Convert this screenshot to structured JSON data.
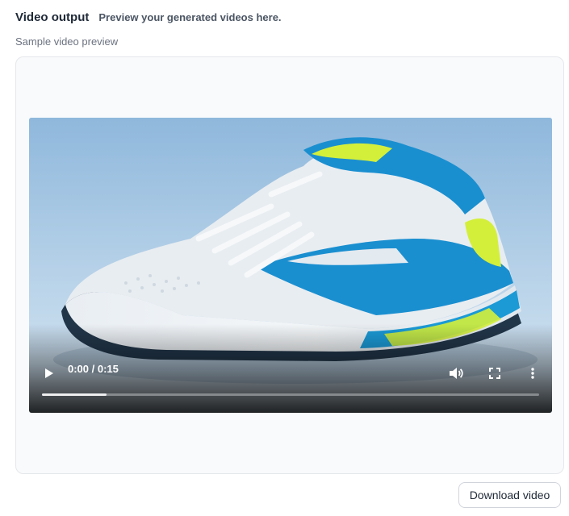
{
  "header": {
    "title": "Video output",
    "subtitle": "Preview your generated videos here."
  },
  "caption": "Sample video preview",
  "video": {
    "time_display": "0:00 / 0:15",
    "progress": 0.13,
    "controls": {
      "play_icon": "play-icon",
      "volume_icon": "volume-icon",
      "fullscreen_icon": "fullscreen-icon",
      "more_icon": "more-vertical-icon"
    }
  },
  "actions": {
    "download_label": "Download video"
  },
  "colors": {
    "panel_bg": "#f8fafc",
    "shoe_blue": "#1a8fd0",
    "shoe_lime": "#d4ef3a"
  }
}
